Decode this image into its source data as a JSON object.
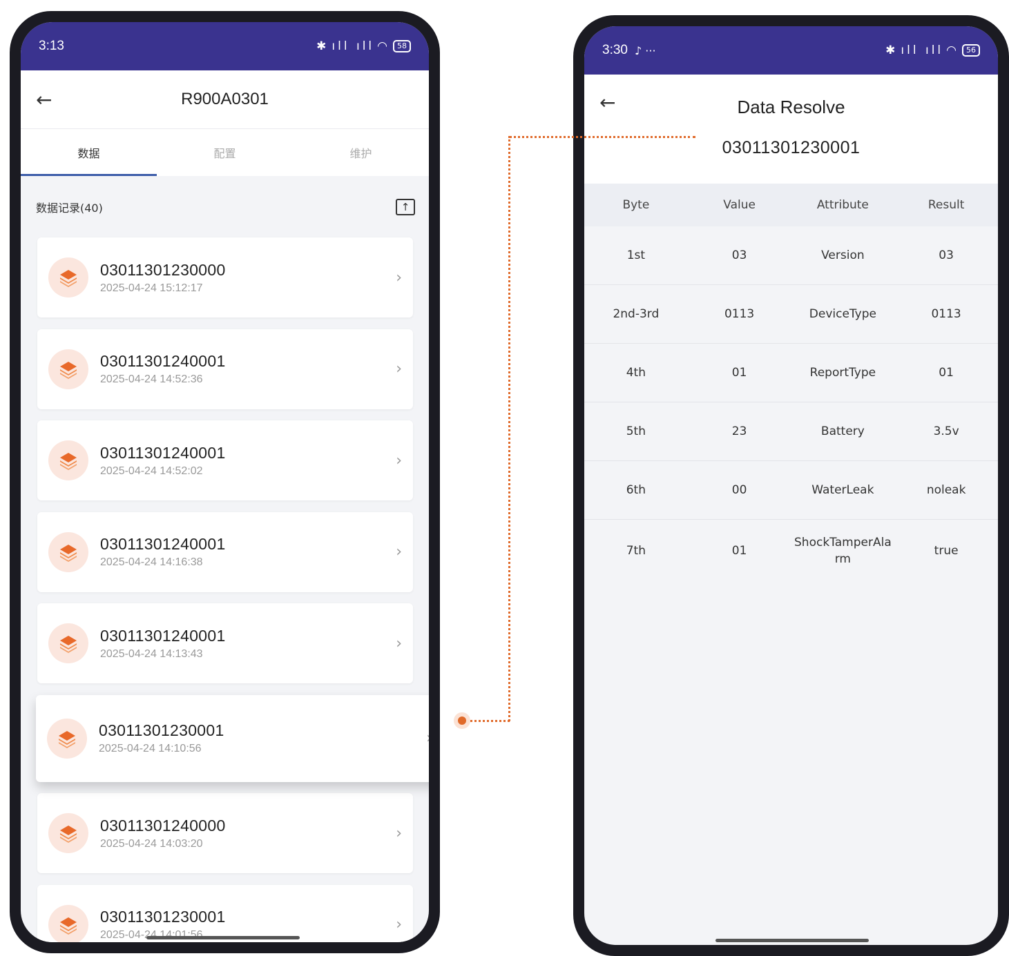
{
  "left": {
    "status_time": "3:13",
    "battery": "58",
    "title": "R900A0301",
    "tabs": [
      "数据",
      "配置",
      "维护"
    ],
    "section_title": "数据记录(40)",
    "records": [
      {
        "id": "03011301230000",
        "date": "2025-04-24 15:12:17"
      },
      {
        "id": "03011301240001",
        "date": "2025-04-24 14:52:36"
      },
      {
        "id": "03011301240001",
        "date": "2025-04-24 14:52:02"
      },
      {
        "id": "03011301240001",
        "date": "2025-04-24 14:16:38"
      },
      {
        "id": "03011301240001",
        "date": "2025-04-24 14:13:43"
      },
      {
        "id": "03011301230001",
        "date": "2025-04-24 14:10:56"
      },
      {
        "id": "03011301240000",
        "date": "2025-04-24 14:03:20"
      },
      {
        "id": "03011301230001",
        "date": "2025-04-24 14:01:56"
      }
    ]
  },
  "right": {
    "status_time": "3:30",
    "battery": "56",
    "title": "Data Resolve",
    "subtitle": "03011301230001",
    "columns": [
      "Byte",
      "Value",
      "Attribute",
      "Result"
    ],
    "rows": [
      [
        "1st",
        "03",
        "Version",
        "03"
      ],
      [
        "2nd-3rd",
        "0113",
        "DeviceType",
        "0113"
      ],
      [
        "4th",
        "01",
        "ReportType",
        "01"
      ],
      [
        "5th",
        "23",
        "Battery",
        "3.5v"
      ],
      [
        "6th",
        "00",
        "WaterLeak",
        "noleak"
      ],
      [
        "7th",
        "01",
        "ShockTamperAlarm",
        "true"
      ]
    ]
  },
  "colors": {
    "status_bar": "#3a338f",
    "accent": "#e06a2a",
    "tab_indicator": "#3a5ba8"
  }
}
